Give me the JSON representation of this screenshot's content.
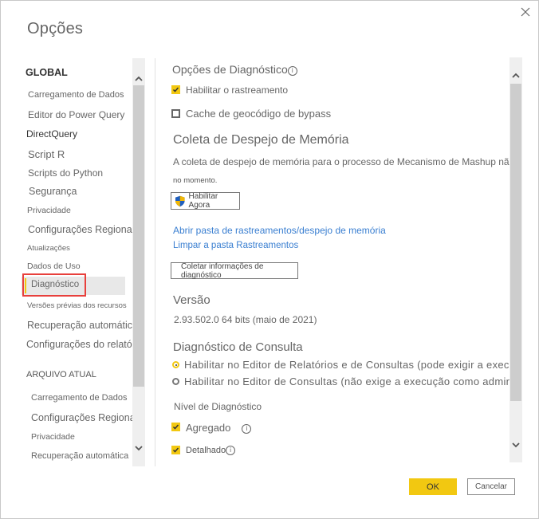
{
  "dialog": {
    "title": "Opções",
    "close_icon": "close-icon"
  },
  "sidebar": {
    "global_header": "GLOBAL",
    "global_items": [
      {
        "label": "Carregamento de Dados"
      },
      {
        "label": "Editor do Power Query"
      },
      {
        "label": "DirectQuery"
      },
      {
        "label": "Script R"
      },
      {
        "label": "Scripts do Python"
      },
      {
        "label": "Segurança"
      },
      {
        "label": "Privacidade"
      },
      {
        "label": "Configurações Regionais"
      },
      {
        "label": "Atualizações"
      },
      {
        "label": "Dados de Uso"
      },
      {
        "label": "Diagnóstico",
        "selected": true
      },
      {
        "label": "Versões prévias dos recursos"
      },
      {
        "label": "Recuperação automática"
      },
      {
        "label": "Configurações do relatório"
      }
    ],
    "current_header": "ARQUIVO ATUAL",
    "current_items": [
      {
        "label": "Carregamento de Dados"
      },
      {
        "label": "Configurações Regionais"
      },
      {
        "label": "Privacidade"
      },
      {
        "label": "Recuperação automática"
      }
    ]
  },
  "content": {
    "diag_options": {
      "title": "Opções de Diagnóstico",
      "enable_tracing": {
        "label": "Habilitar o rastreamento",
        "checked": true
      },
      "bypass_geocode": {
        "label": "Cache de geocódigo de bypass",
        "checked": false
      }
    },
    "dump": {
      "title": "Coleta de Despejo de Memória",
      "description": "A coleta de despejo de memória para o processo de Mecanismo de Mashup não es",
      "description_cont": "no momento.",
      "enable_now_button": "Habilitar Agora",
      "open_folder_link": "Abrir pasta de rastreamentos/despejo de memória",
      "clear_folder_link": "Limpar a pasta Rastreamentos",
      "collect_button": "Coletar informações de diagnóstico"
    },
    "version": {
      "title": "Versão",
      "value": "2.93.502.0 64 bits (maio de 2021)"
    },
    "query_diag": {
      "title": "Diagnóstico de Consulta",
      "options": [
        {
          "label": "Habilitar no Editor de Relatórios e de Consultas (pode exigir a execução co",
          "selected": true
        },
        {
          "label": "Habilitar no Editor de Consultas (não exige a execução como administrador",
          "selected": false
        }
      ],
      "level_title": "Nível de Diagnóstico",
      "aggregated": {
        "label": "Agregado",
        "checked": true
      },
      "detailed": {
        "label": "Detalhado",
        "checked": true
      }
    }
  },
  "footer": {
    "ok_label": "OK",
    "cancel_label": "Cancelar"
  },
  "colors": {
    "accent": "#f2c811",
    "link": "#3a7fd1",
    "highlight_box": "#e8403c"
  }
}
